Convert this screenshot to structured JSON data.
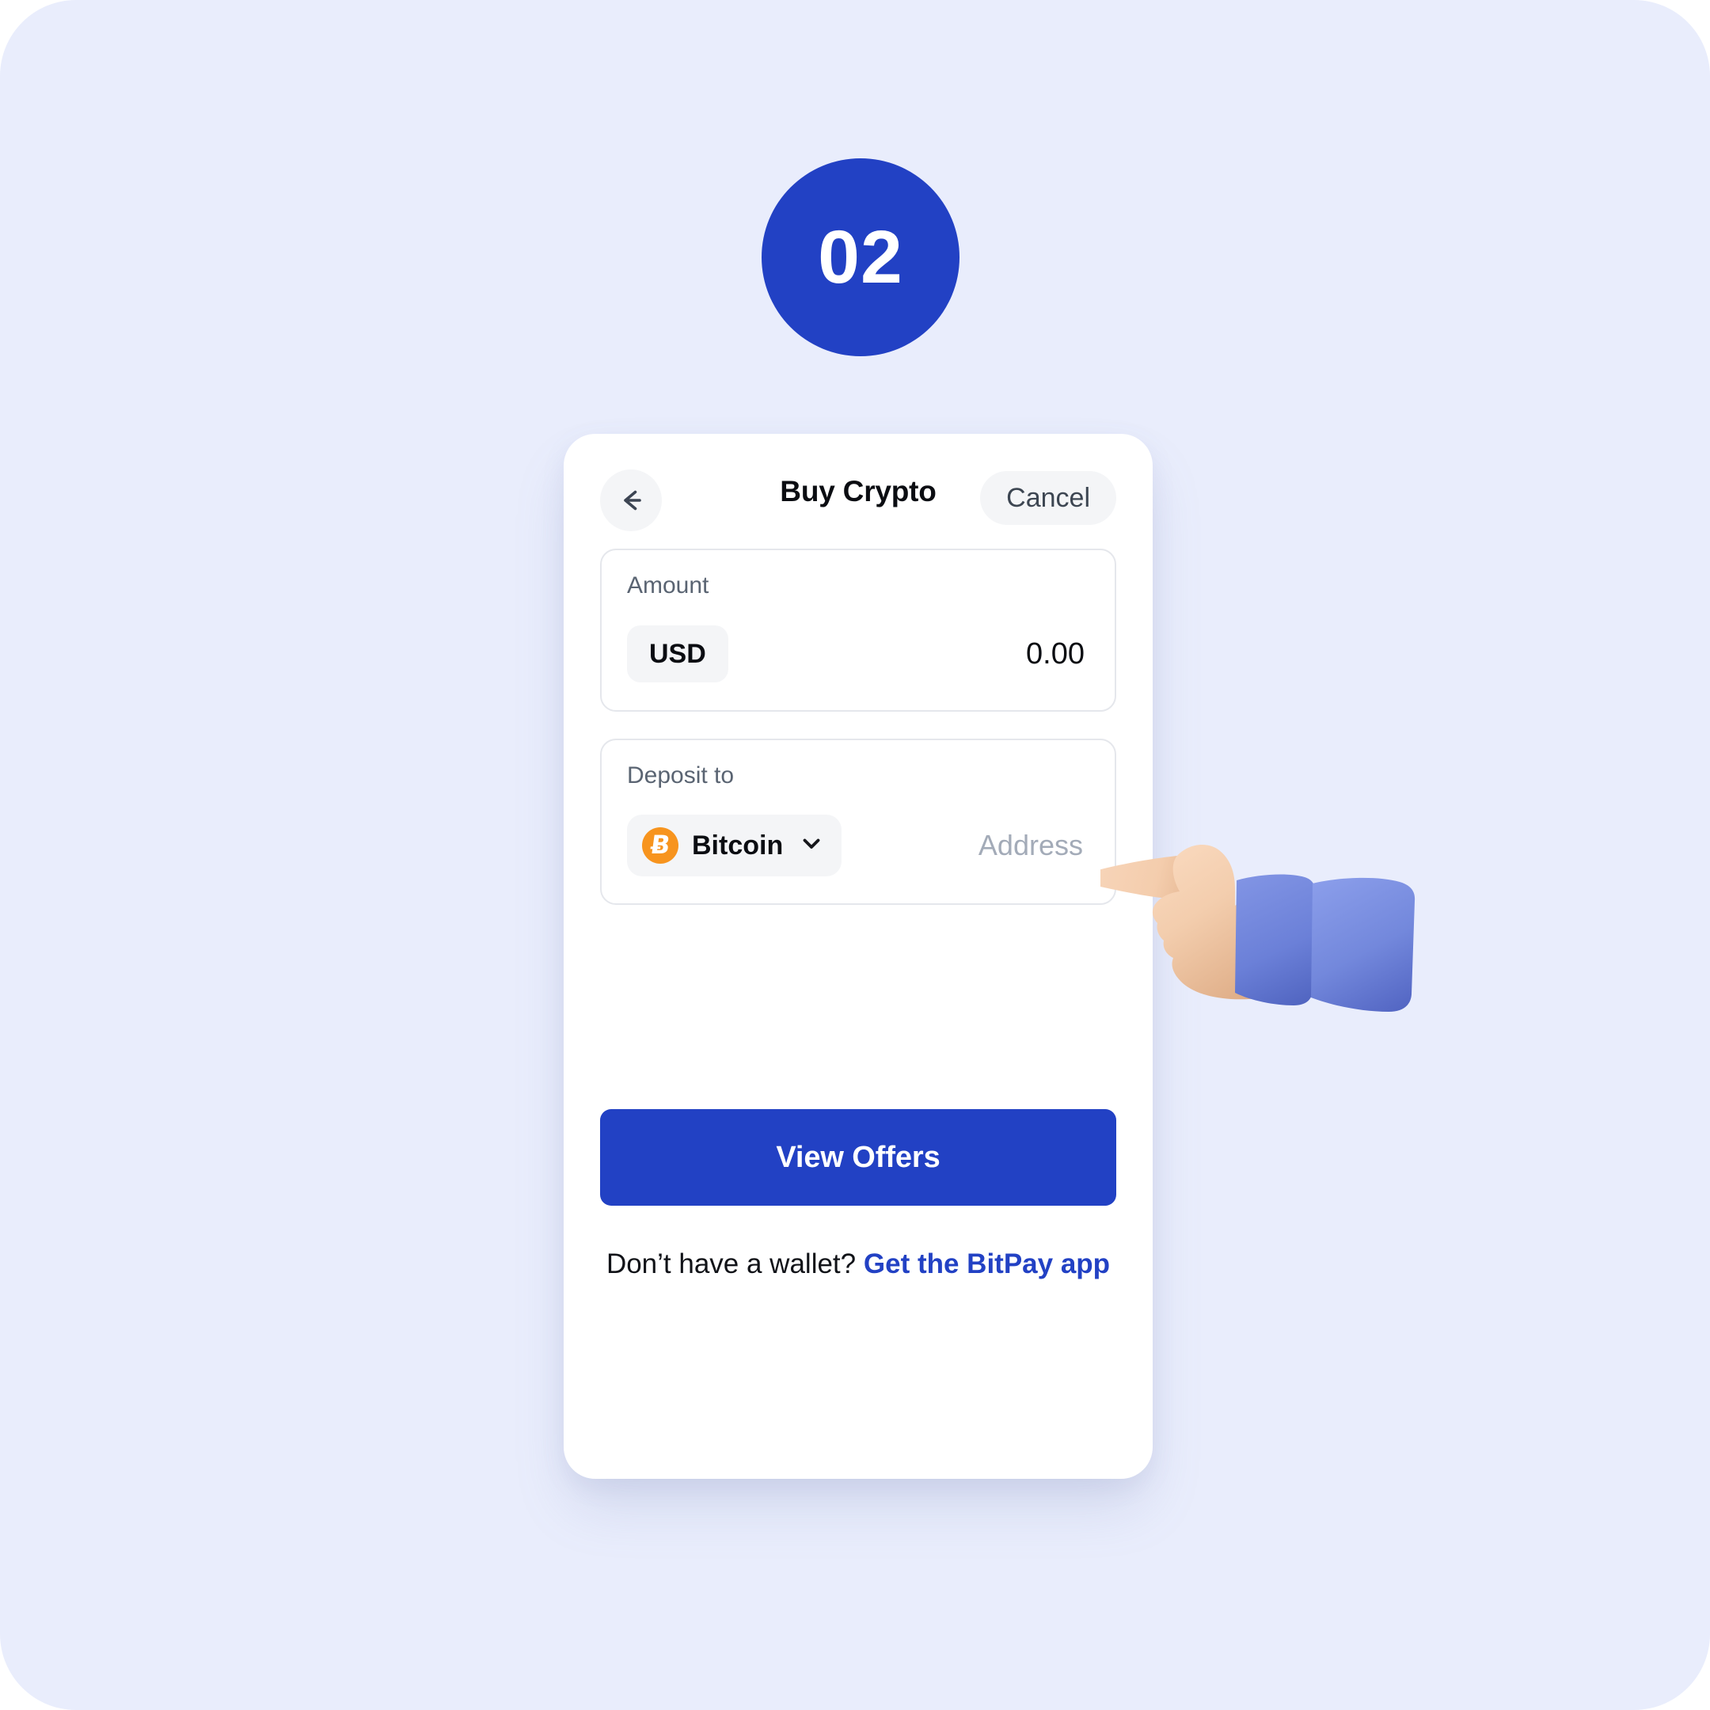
{
  "step": {
    "number": "02"
  },
  "card": {
    "header": {
      "back_icon": "arrow-left-icon",
      "title": "Buy Crypto",
      "cancel_label": "Cancel"
    },
    "amount_section": {
      "label": "Amount",
      "currency": "USD",
      "value": "0.00"
    },
    "deposit_section": {
      "label": "Deposit to",
      "asset_icon": "bitcoin-icon",
      "asset_glyph": "Ƀ",
      "asset_name": "Bitcoin",
      "chevron_icon": "chevron-down-icon",
      "address_placeholder": "Address"
    },
    "cta": {
      "label": "View Offers"
    },
    "footer": {
      "text": "Don’t have a wallet?",
      "link_label": "Get the BitPay app"
    }
  },
  "illustration": {
    "name": "pointing-hand-3d",
    "skin_color": "#F2CDAE",
    "sleeve_color": "#6B80D8"
  },
  "colors": {
    "page_background": "#E9EDFC",
    "brand_blue": "#2241C4",
    "bitcoin_orange": "#F7941E",
    "card_white": "#FFFFFF",
    "pill_gray": "#F4F5F7",
    "border_gray": "#E5E7EC",
    "placeholder_gray": "#A3ABB8"
  }
}
